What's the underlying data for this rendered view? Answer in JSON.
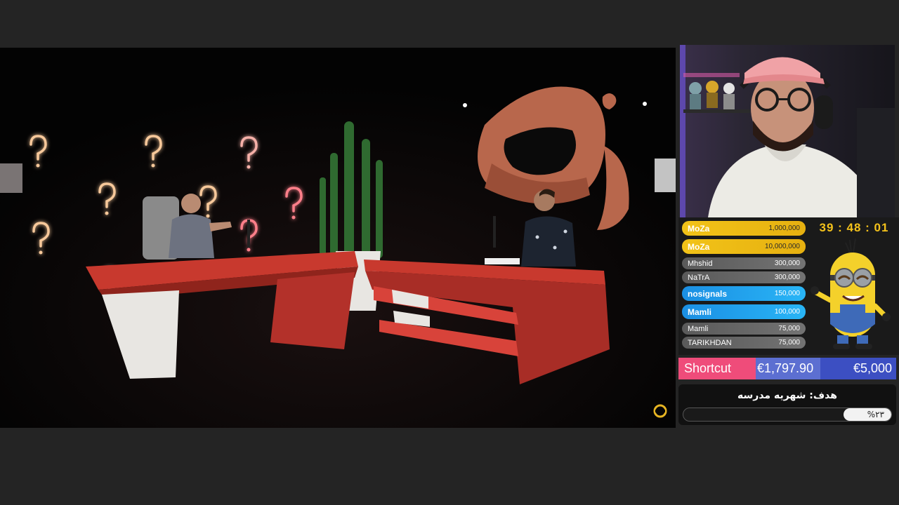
{
  "video": {
    "watermark_icon": "channel-logo-icon",
    "scene": "talk-show-studio"
  },
  "timer": "39 : 48 : 01",
  "donors": [
    {
      "name": "MoZa",
      "amount": "1,000,000",
      "tier": "gold"
    },
    {
      "name": "MoZa",
      "amount": "10,000,000",
      "tier": "gold"
    },
    {
      "name": "Mhshid",
      "amount": "300,000",
      "tier": "grey"
    },
    {
      "name": "NaTrA",
      "amount": "300,000",
      "tier": "grey"
    },
    {
      "name": "nosignals",
      "amount": "150,000",
      "tier": "blue"
    },
    {
      "name": "Mamli",
      "amount": "100,000",
      "tier": "blue"
    },
    {
      "name": "Mamli",
      "amount": "75,000",
      "tier": "grey"
    },
    {
      "name": "TARIKHDAN",
      "amount": "75,000",
      "tier": "grey"
    }
  ],
  "shortcut": {
    "label": "Shortcut",
    "current": "€1,797.90",
    "goal": "€5,000"
  },
  "goal": {
    "title": "هدف: شهریه مدرسه",
    "percent_label": "%۲۳",
    "progress": 0.23
  },
  "colors": {
    "gold": "#f2c318",
    "blue": "#1b8fe3",
    "pink": "#ef4c7a",
    "indigo": "#3c4fc2",
    "desk_red": "#c8392e"
  }
}
